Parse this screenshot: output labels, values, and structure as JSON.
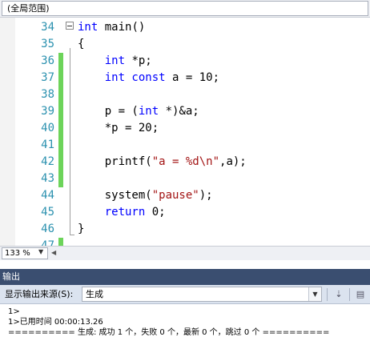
{
  "scope": {
    "label": "(全局范围)"
  },
  "editor": {
    "lines": [
      {
        "n": "34",
        "tokens": [
          {
            "t": "int",
            "k": "kw"
          },
          {
            "t": " main()",
            "k": ""
          }
        ]
      },
      {
        "n": "35",
        "tokens": [
          {
            "t": "{",
            "k": ""
          }
        ]
      },
      {
        "n": "36",
        "tokens": [
          {
            "t": "    ",
            "k": ""
          },
          {
            "t": "int",
            "k": "kw"
          },
          {
            "t": " *p;",
            "k": ""
          }
        ]
      },
      {
        "n": "37",
        "tokens": [
          {
            "t": "    ",
            "k": ""
          },
          {
            "t": "int const",
            "k": "kw"
          },
          {
            "t": " a = 10;",
            "k": ""
          }
        ]
      },
      {
        "n": "38",
        "tokens": []
      },
      {
        "n": "39",
        "tokens": [
          {
            "t": "    p = (",
            "k": ""
          },
          {
            "t": "int",
            "k": "kw"
          },
          {
            "t": " *)&a;",
            "k": ""
          }
        ]
      },
      {
        "n": "40",
        "tokens": [
          {
            "t": "    *p = 20;",
            "k": ""
          }
        ]
      },
      {
        "n": "41",
        "tokens": []
      },
      {
        "n": "42",
        "tokens": [
          {
            "t": "    printf(",
            "k": ""
          },
          {
            "t": "\"a = %d\\n\"",
            "k": "str"
          },
          {
            "t": ",a);",
            "k": ""
          }
        ]
      },
      {
        "n": "43",
        "tokens": []
      },
      {
        "n": "44",
        "tokens": [
          {
            "t": "    system(",
            "k": ""
          },
          {
            "t": "\"pause\"",
            "k": "str"
          },
          {
            "t": ");",
            "k": ""
          }
        ]
      },
      {
        "n": "45",
        "tokens": [
          {
            "t": "    ",
            "k": ""
          },
          {
            "t": "return",
            "k": "kw"
          },
          {
            "t": " 0;",
            "k": ""
          }
        ]
      },
      {
        "n": "46",
        "tokens": [
          {
            "t": "}",
            "k": ""
          }
        ]
      },
      {
        "n": "47",
        "tokens": []
      }
    ],
    "changed_lines": [
      "36",
      "37",
      "38",
      "39",
      "40",
      "41",
      "42",
      "43",
      "47"
    ],
    "colors": {
      "keyword": "#0000ff",
      "string": "#a31515",
      "line_number": "#2b91af",
      "change_bar": "#6dd45a"
    }
  },
  "zoom": {
    "level": "133 %"
  },
  "output": {
    "title": "输出",
    "source_label": "显示输出来源(S):",
    "source_value": "生成",
    "lines": [
      "1>",
      "1>已用时间 00:00:13.26",
      "========== 生成: 成功 1 个，失败 0 个，最新 0 个，跳过 0 个 =========="
    ],
    "colors": {
      "title_bg": "#3a4e70",
      "toolbar_bg": "#dbe3ef"
    }
  }
}
